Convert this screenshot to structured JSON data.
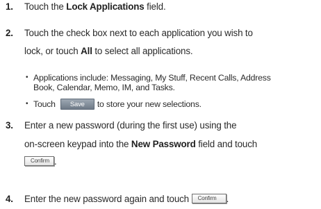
{
  "steps": [
    {
      "number": "1.",
      "line1_a": "Touch the ",
      "line1_b": "Lock Applications",
      "line1_c": " field."
    },
    {
      "number": "2.",
      "line1_a": "Touch the check box next to each application you wish to",
      "line2_a": "lock, or touch ",
      "line2_b": "All",
      "line2_c": " to select all applications."
    },
    {
      "number": "3.",
      "line1_a": "Enter a new password (during the first use) using the",
      "line2_a": "on-screen keypad into the ",
      "line2_b": "New Password",
      "line2_c": " field and touch",
      "line3_c": "."
    },
    {
      "number": "4.",
      "line1_a": "Enter the new password again and touch",
      "line1_c": "."
    }
  ],
  "bullets": [
    {
      "symbol": "•",
      "line1": "Applications include: Messaging, My Stuff, Recent Calls, Address",
      "line2": "Book, Calendar, Memo, IM, and Tasks."
    },
    {
      "symbol": "•",
      "before": "Touch",
      "after": "to store your new selections."
    }
  ],
  "buttons": {
    "save_label": "Save",
    "confirm_label": "Confirm"
  }
}
